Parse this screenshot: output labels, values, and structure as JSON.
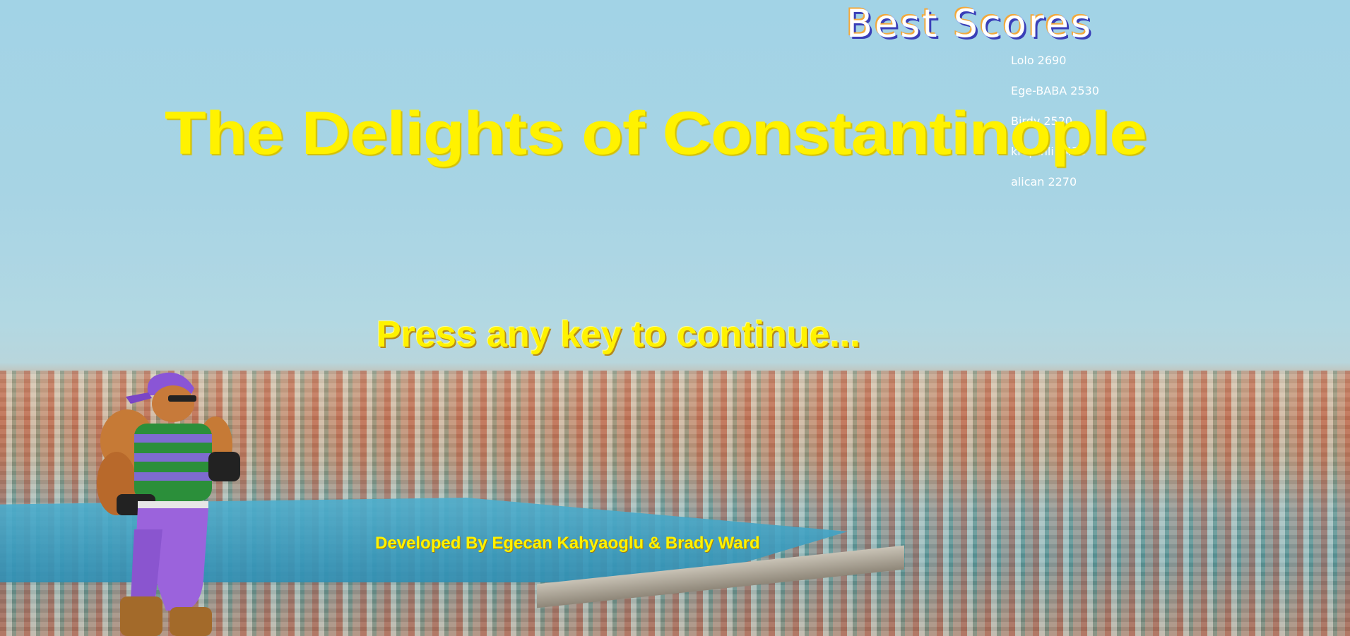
{
  "title_screen": {
    "game_title": "The Delights of Constantinople",
    "prompt": "Press any key to continue...",
    "credits": "Developed By Egecan Kahyaoglu & Brady Ward"
  },
  "leaderboard": {
    "heading": "Best Scores",
    "entries": [
      {
        "name": "Lolo",
        "score": "2690"
      },
      {
        "name": "Ege-BABA",
        "score": "2530"
      },
      {
        "name": "Birdy",
        "score": "2520"
      },
      {
        "name": "kreptnli",
        "score": "2470"
      },
      {
        "name": "alican",
        "score": "2270"
      }
    ]
  },
  "colors": {
    "title_yellow": "#fff200",
    "sky": "#a2d3e6"
  },
  "icons": {
    "character": "fighter-character-sprite"
  }
}
